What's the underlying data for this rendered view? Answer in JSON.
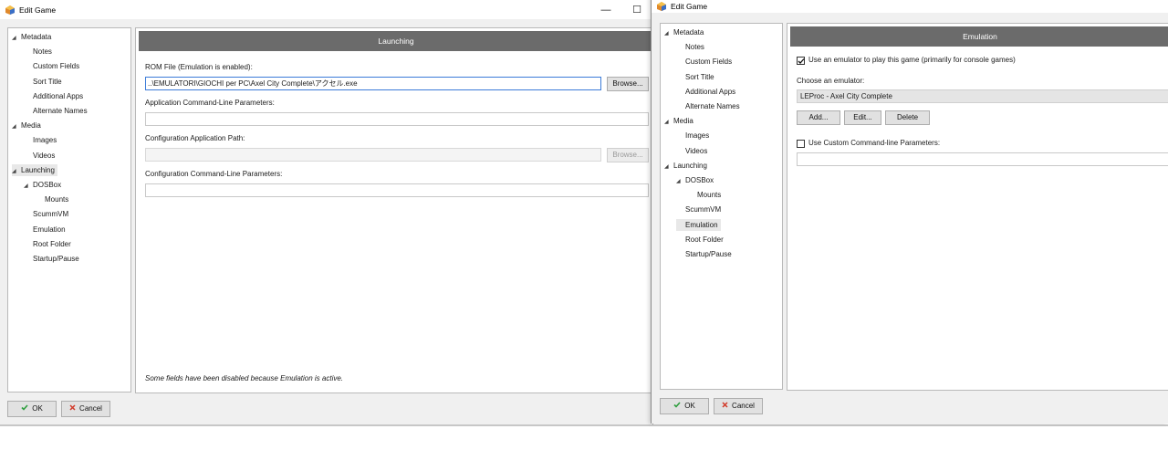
{
  "left_window": {
    "title": "Edit Game",
    "controls": {
      "minimize": "—",
      "maximize": "☐"
    },
    "tree": [
      {
        "label": "Metadata",
        "level": 0,
        "expanded": true
      },
      {
        "label": "Notes",
        "level": 1
      },
      {
        "label": "Custom Fields",
        "level": 1
      },
      {
        "label": "Sort Title",
        "level": 1
      },
      {
        "label": "Additional Apps",
        "level": 1
      },
      {
        "label": "Alternate Names",
        "level": 1
      },
      {
        "label": "Media",
        "level": 0,
        "expanded": true
      },
      {
        "label": "Images",
        "level": 1
      },
      {
        "label": "Videos",
        "level": 1
      },
      {
        "label": "Launching",
        "level": 0,
        "expanded": true,
        "selected": true
      },
      {
        "label": "DOSBox",
        "level": 1,
        "expanded": true
      },
      {
        "label": "Mounts",
        "level": 2
      },
      {
        "label": "ScummVM",
        "level": 1
      },
      {
        "label": "Emulation",
        "level": 1
      },
      {
        "label": "Root Folder",
        "level": 1
      },
      {
        "label": "Startup/Pause",
        "level": 1
      }
    ],
    "panel": {
      "header": "Launching",
      "rom_label": "ROM File (Emulation is enabled):",
      "rom_value": "..\\EMULATORI\\GIOCHI per PC\\Axel City Complete\\アクセル.exe",
      "browse_label": "Browse...",
      "app_params_label": "Application Command-Line Parameters:",
      "app_params_value": "",
      "config_path_label": "Configuration Application Path:",
      "config_path_value": "",
      "config_browse_label": "Browse...",
      "config_params_label": "Configuration Command-Line Parameters:",
      "config_params_value": "",
      "note": "Some fields have been disabled because Emulation is active."
    },
    "ok_label": "OK",
    "cancel_label": "Cancel"
  },
  "right_window": {
    "title": "Edit Game",
    "tree": [
      {
        "label": "Metadata",
        "level": 0,
        "expanded": true
      },
      {
        "label": "Notes",
        "level": 1
      },
      {
        "label": "Custom Fields",
        "level": 1
      },
      {
        "label": "Sort Title",
        "level": 1
      },
      {
        "label": "Additional Apps",
        "level": 1
      },
      {
        "label": "Alternate Names",
        "level": 1
      },
      {
        "label": "Media",
        "level": 0,
        "expanded": true
      },
      {
        "label": "Images",
        "level": 1
      },
      {
        "label": "Videos",
        "level": 1
      },
      {
        "label": "Launching",
        "level": 0,
        "expanded": true
      },
      {
        "label": "DOSBox",
        "level": 1,
        "expanded": true
      },
      {
        "label": "Mounts",
        "level": 2
      },
      {
        "label": "ScummVM",
        "level": 1
      },
      {
        "label": "Emulation",
        "level": 1,
        "selected": true
      },
      {
        "label": "Root Folder",
        "level": 1
      },
      {
        "label": "Startup/Pause",
        "level": 1
      }
    ],
    "panel": {
      "header": "Emulation",
      "use_emulator_label": "Use an emulator to play this game (primarily for console games)",
      "use_emulator_checked": true,
      "choose_label": "Choose an emulator:",
      "emulator_value": "LEProc - Axel City Complete",
      "add_label": "Add...",
      "edit_label": "Edit...",
      "delete_label": "Delete",
      "custom_params_label": "Use Custom Command-line Parameters:",
      "custom_params_checked": false,
      "custom_params_value": ""
    },
    "ok_label": "OK",
    "cancel_label": "Cancel"
  },
  "colors": {
    "header_bg": "#6b6b6b",
    "ok_check": "#2e9e3e",
    "cancel_x": "#d23a2a",
    "active_border": "#3b7bd8"
  },
  "icons": {
    "app": "launchbox-icon",
    "ok": "check-icon",
    "cancel": "x-icon",
    "expand": "triangle-expanded-icon"
  }
}
